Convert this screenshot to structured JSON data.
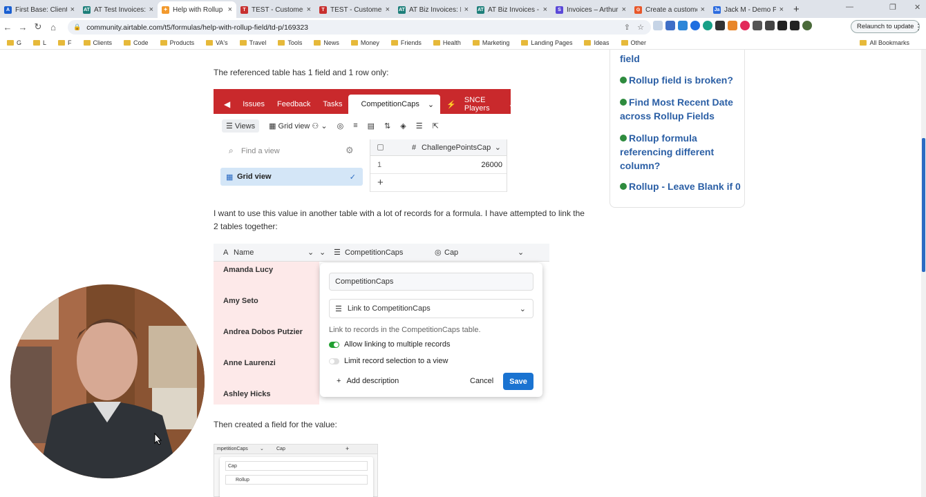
{
  "browser": {
    "tabs": [
      {
        "title": "First Base: Clients",
        "color": "#1a5fd1",
        "letter": "A"
      },
      {
        "title": "AT Test Invoices: C",
        "color": "#1d7f7a",
        "letter": "AT"
      },
      {
        "title": "Help with Rollup F",
        "color": "#f29a2e",
        "letter": "✦"
      },
      {
        "title": "TEST - Customer",
        "color": "#c8302f",
        "letter": "T"
      },
      {
        "title": "TEST - Customer",
        "color": "#c8302f",
        "letter": "T"
      },
      {
        "title": "AT Biz Invoices: In",
        "color": "#1d7f7a",
        "letter": "AT"
      },
      {
        "title": "AT Biz Invoices - A",
        "color": "#1d7f7a",
        "letter": "AT"
      },
      {
        "title": "Invoices – Arthur",
        "color": "#5a48d8",
        "letter": "S"
      },
      {
        "title": "Create a custome",
        "color": "#e8572a",
        "letter": "⊙"
      },
      {
        "title": "Jack M - Demo P",
        "color": "#2d6cdf",
        "letter": "Ja"
      }
    ],
    "url": "community.airtable.com/t5/formulas/help-with-rollup-field/td-p/169323",
    "relaunch_label": "Relaunch to update",
    "bookmarks": [
      "G",
      "L",
      "F",
      "Clients",
      "Code",
      "Products",
      "VA's",
      "Travel",
      "Tools",
      "News",
      "Money",
      "Friends",
      "Health",
      "Marketing",
      "Landing Pages",
      "Ideas",
      "Other"
    ],
    "all_bookmarks": "All Bookmarks"
  },
  "post": {
    "para1": "The referenced table has 1 field and 1 row only:",
    "para2": "I want to use this value in another table with a lot of records for a formula. I have attempted to link the 2 tables together:",
    "para3": "Then created a field for the value:"
  },
  "screenshot1": {
    "tabs": [
      "Issues",
      "Feedback",
      "Tasks",
      "CompetitionCaps",
      "SNCE Players"
    ],
    "views_label": "Views",
    "grid_view_label": "Grid view",
    "find_placeholder": "Find a view",
    "selected_view": "Grid view",
    "field_header": "ChallengePointsCap",
    "row_number": "1",
    "row_value": "26000",
    "add_row": "+"
  },
  "screenshot2": {
    "col_name": "Name",
    "col_link": "CompetitionCaps",
    "col_cap": "Cap",
    "names": [
      "Amanda Lucy",
      "Amy Seto",
      "Andrea Dobos Putzier",
      "Anne Laurenzi",
      "Ashley Hicks"
    ],
    "dialog": {
      "field_name": "CompetitionCaps",
      "field_type": "Link to CompetitionCaps",
      "description": "Link to records in the CompetitionCaps table.",
      "opt_multiple": "Allow linking to multiple records",
      "opt_multiple_on": true,
      "opt_limit": "Limit record selection to a view",
      "opt_limit_on": false,
      "add_desc": "Add description",
      "cancel": "Cancel",
      "save": "Save"
    }
  },
  "screenshot3": {
    "col1": "mpetitionCaps",
    "col2": "Cap",
    "add": "+",
    "field_name": "Cap",
    "field_type": "Rollup"
  },
  "sidebar": {
    "partial": "field",
    "links": [
      "Rollup field is broken?",
      "Find Most Recent Date across Rollup Fields",
      "Rollup formula referencing different column?",
      "Rollup - Leave Blank if 0"
    ]
  },
  "colors": {
    "airtable_red": "#c9292c",
    "link_blue": "#2b5fa5",
    "save_blue": "#1a73d1",
    "toggle_on": "#20a030"
  }
}
